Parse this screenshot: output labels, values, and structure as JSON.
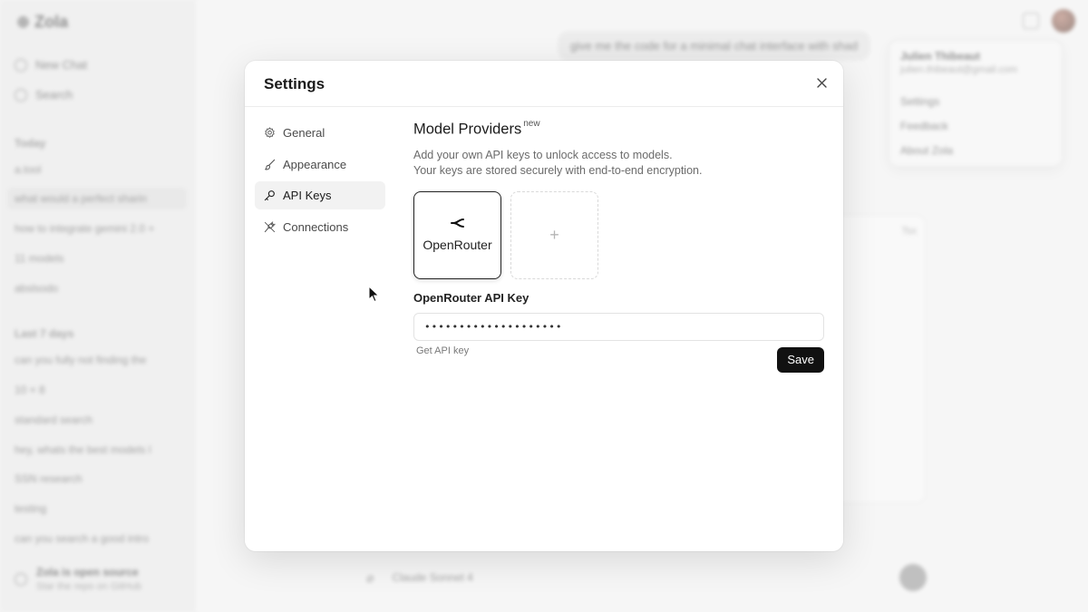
{
  "background": {
    "brand": "⊕ Zola",
    "sidebar": {
      "actions": [
        {
          "label": "New Chat",
          "icon": "new-chat-icon"
        },
        {
          "label": "Search",
          "icon": "search-icon"
        }
      ],
      "today_heading": "Today",
      "today_items": [
        "a.tool",
        "what would a perfect sharin",
        "how to integrate gemini 2.0 +",
        "11 models",
        "abslsodo"
      ],
      "lastweek_heading": "Last 7 days",
      "lastweek_items": [
        "can you fully not finding the",
        "10 × 8",
        "standard search",
        "hey, whats the best models l",
        "SSN research",
        "testing",
        "can you search a good intro"
      ],
      "footer_title": "Zola is open source",
      "footer_subtitle": "Star the repo on GitHub"
    },
    "user_message": "give me the code for a minimal chat interface with shad",
    "user_menu": {
      "name": "Julien Thibeaut",
      "email": "julien.thibeaut@gmail.com",
      "items": [
        "Settings",
        "Feedback",
        "About Zola"
      ]
    },
    "code_language": "Tsx",
    "composer_model": "Claude Sonnet 4"
  },
  "modal": {
    "title": "Settings",
    "close_icon": "close-icon",
    "nav": [
      {
        "label": "General",
        "icon": "gear-icon",
        "active": false
      },
      {
        "label": "Appearance",
        "icon": "brush-icon",
        "active": false
      },
      {
        "label": "API Keys",
        "icon": "key-icon",
        "active": true
      },
      {
        "label": "Connections",
        "icon": "plug-icon",
        "active": false
      }
    ],
    "section_title": "Model Providers",
    "section_badge": "new",
    "description_line1": "Add your own API keys to unlock access to models.",
    "description_line2": "Your keys are stored securely with end-to-end encryption.",
    "providers": [
      {
        "name": "OpenRouter",
        "icon": "openrouter-icon",
        "selected": true
      }
    ],
    "add_provider_symbol": "+",
    "api_key_label": "OpenRouter API Key",
    "api_key_value": "••••••••••••••••••••",
    "get_key_link": "Get API key",
    "save_label": "Save"
  }
}
